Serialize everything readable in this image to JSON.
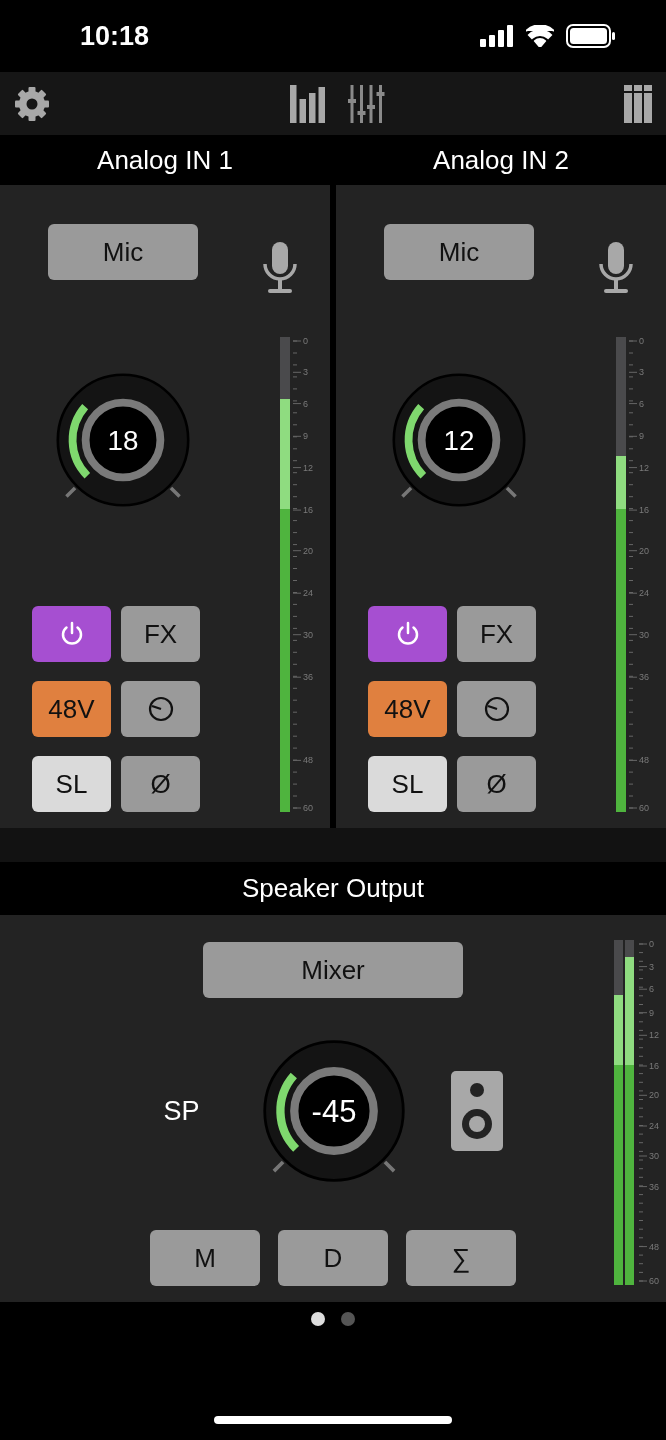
{
  "status_bar": {
    "time": "10:18"
  },
  "channels": [
    {
      "title": "Analog IN 1",
      "input_button": "Mic",
      "gain": {
        "value": "18"
      },
      "buttons": [
        {
          "kind": "power",
          "on": true,
          "color": "#a64fd1"
        },
        {
          "kind": "text",
          "label": "FX",
          "on": false
        },
        {
          "kind": "text",
          "label": "48V",
          "on": true,
          "color": "#e0803f"
        },
        {
          "kind": "clock",
          "on": false
        },
        {
          "kind": "text",
          "label": "SL",
          "on": true,
          "color": "#dadada"
        },
        {
          "kind": "text",
          "label": "Ø",
          "on": false
        }
      ],
      "meter": {
        "level": 0.87,
        "scale": [
          "0",
          "3",
          "6",
          "9",
          "12",
          "16",
          "20",
          "24",
          "30",
          "36",
          "48",
          "60"
        ]
      }
    },
    {
      "title": "Analog IN 2",
      "input_button": "Mic",
      "gain": {
        "value": "12"
      },
      "buttons": [
        {
          "kind": "power",
          "on": true,
          "color": "#a64fd1"
        },
        {
          "kind": "text",
          "label": "FX",
          "on": false
        },
        {
          "kind": "text",
          "label": "48V",
          "on": true,
          "color": "#e0803f"
        },
        {
          "kind": "clock",
          "on": false
        },
        {
          "kind": "text",
          "label": "SL",
          "on": true,
          "color": "#dadada"
        },
        {
          "kind": "text",
          "label": "Ø",
          "on": false
        }
      ],
      "meter": {
        "level": 0.75,
        "scale": [
          "0",
          "3",
          "6",
          "9",
          "12",
          "16",
          "20",
          "24",
          "30",
          "36",
          "48",
          "60"
        ]
      }
    }
  ],
  "output": {
    "title": "Speaker Output",
    "source_button": "Mixer",
    "label": "SP",
    "volume": {
      "value": "-45"
    },
    "buttons": [
      {
        "label": "M",
        "on": false
      },
      {
        "label": "D",
        "on": false
      },
      {
        "label": "∑",
        "on": false
      }
    ],
    "meter": {
      "levels": [
        {
          "level": 0.84
        },
        {
          "level": 0.95
        }
      ],
      "scale": [
        "0",
        "3",
        "6",
        "9",
        "12",
        "16",
        "20",
        "24",
        "30",
        "36",
        "48",
        "60"
      ]
    }
  },
  "pages": [
    {
      "selected": true
    },
    {
      "selected": false
    }
  ]
}
